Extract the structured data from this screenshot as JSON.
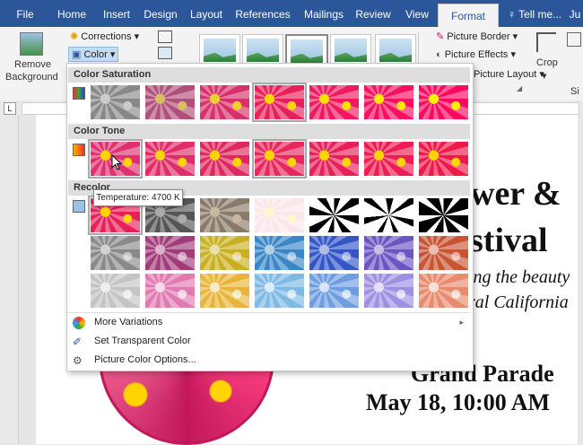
{
  "tabs": [
    "File",
    "Home",
    "Insert",
    "Design",
    "Layout",
    "References",
    "Mailings",
    "Review",
    "View",
    "Format"
  ],
  "tell_me": "Tell me...",
  "user_initials": "Ju",
  "ribbon": {
    "remove_background_line1": "Remove",
    "remove_background_line2": "Background",
    "corrections": "Corrections",
    "color": "Color",
    "picture_border": "Picture Border",
    "picture_effects": "Picture Effects",
    "picture_layout": "Picture Layout",
    "crop": "Crop",
    "size_group_partial": "Si"
  },
  "dropdown": {
    "color_saturation": "Color Saturation",
    "color_tone": "Color Tone",
    "recolor": "Recolor",
    "more_variations": "More Variations",
    "set_transparent_color": "Set Transparent Color",
    "picture_color_options": "Picture Color Options..."
  },
  "tooltip": "Temperature: 4700 K",
  "document": {
    "title_line1": "wer &",
    "title_line2": "stival",
    "sub_line1": "ing the beauty",
    "sub_line2": "ral California",
    "event": "Grand Parade",
    "date": "May 18, 10:00 AM"
  },
  "colors": {
    "accent": "#2b579a",
    "ribbon_bg": "#f3f3f3",
    "recolor_swatches_row2": [
      "#8a8a8a",
      "#a23b7a",
      "#c9b021",
      "#3b86c6",
      "#3355c8",
      "#6a55c2",
      "#c85434"
    ],
    "recolor_swatches_row3": [
      "#c4c4c4",
      "#e07ab1",
      "#e8b53a",
      "#7fb9e6",
      "#6e9ee0",
      "#9f8fe0",
      "#e88a6e"
    ]
  }
}
